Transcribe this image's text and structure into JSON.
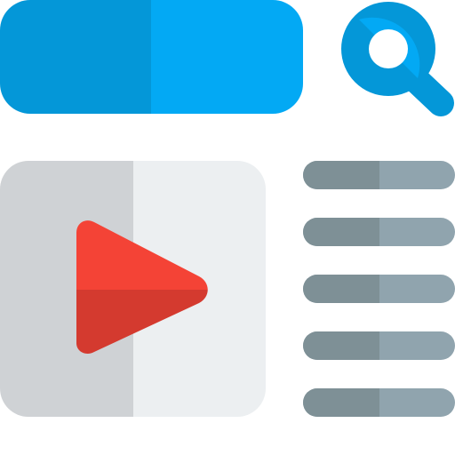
{
  "icon": {
    "name": "video-search-icon",
    "colors": {
      "search_bar_left": "#0497d8",
      "search_bar_right": "#03a9f4",
      "magnifier": "#0497d8",
      "magnifier_lens_ring": "#03a9f4",
      "thumbnail_left": "#cfd2d5",
      "thumbnail_right": "#eceff1",
      "play_top": "#f44336",
      "play_bottom": "#d43a2f",
      "line_left": "#7e9096",
      "line_right": "#90a4ae"
    },
    "parts": {
      "search_bar": "search-bar",
      "magnifier": "magnifier-icon",
      "thumbnail": "video-thumbnail",
      "play": "play-icon",
      "text_lines": [
        "text-line-1",
        "text-line-2",
        "text-line-3",
        "text-line-4",
        "text-line-5"
      ]
    }
  }
}
